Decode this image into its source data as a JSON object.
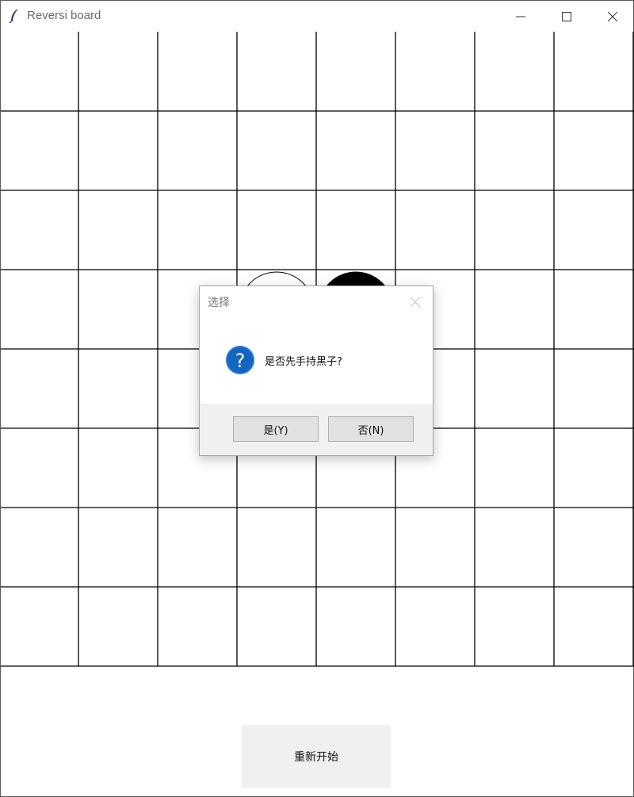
{
  "window": {
    "title": "Reversi board"
  },
  "board": {
    "size": 8,
    "stones": [
      {
        "row": 3,
        "col": 3,
        "color": "white"
      },
      {
        "row": 3,
        "col": 4,
        "color": "black"
      }
    ]
  },
  "controls": {
    "restart_label": "重新开始"
  },
  "dialog": {
    "title": "选择",
    "message": "是否先手持黑子?",
    "yes_label": "是(Y)",
    "no_label": "否(N)",
    "icon": "question-icon"
  },
  "colors": {
    "grid_line": "#000000",
    "dialog_footer": "#f0f0f0",
    "question_icon": "#1565c0"
  }
}
